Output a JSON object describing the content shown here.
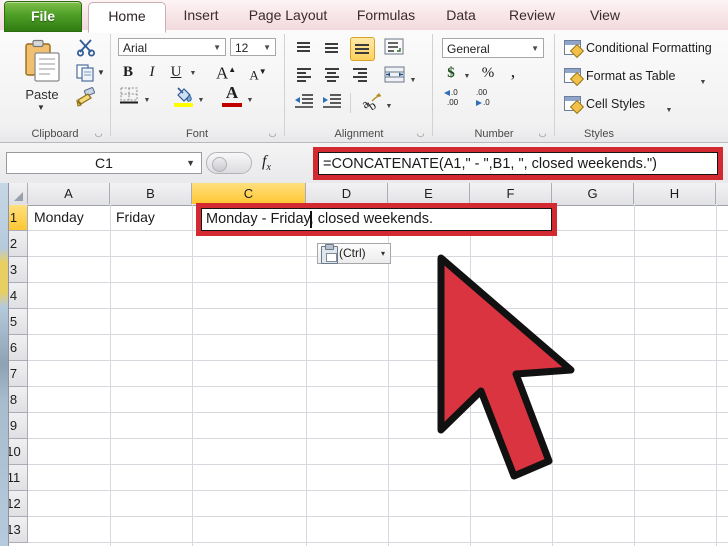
{
  "app": {
    "name": "Microsoft Excel 2010",
    "accent_red": "#d32a32",
    "accent_green": "#4e9e26",
    "selection_yellow": "#ffc732"
  },
  "tabs": [
    {
      "label": "File",
      "state": "file"
    },
    {
      "label": "Home",
      "state": "active"
    },
    {
      "label": "Insert",
      "state": "normal"
    },
    {
      "label": "Page Layout",
      "state": "normal"
    },
    {
      "label": "Formulas",
      "state": "normal"
    },
    {
      "label": "Data",
      "state": "normal"
    },
    {
      "label": "Review",
      "state": "normal"
    },
    {
      "label": "View",
      "state": "normal"
    }
  ],
  "ribbon": {
    "clipboard": {
      "label": "Clipboard",
      "paste_label": "Paste",
      "cut_icon": "scissors-icon",
      "copy_icon": "copy-icon",
      "format_painter_icon": "format-painter-icon",
      "dialog_launcher": "dialog-launcher-icon"
    },
    "font": {
      "label": "Font",
      "font_name": "Arial",
      "font_size": "12",
      "bold": "B",
      "italic": "I",
      "underline": "U",
      "grow_font": "A",
      "shrink_font": "A",
      "borders_icon": "borders-icon",
      "fill_color": "A",
      "fill_color_swatch": "#ffff00",
      "font_color": "A",
      "font_color_swatch": "#c00000",
      "dialog_launcher": "dialog-launcher-icon"
    },
    "alignment": {
      "label": "Alignment",
      "buttons": [
        "align-top",
        "align-middle",
        "align-bottom",
        "wrap-text",
        "align-left",
        "align-center",
        "align-right",
        "merge-and-center",
        "decrease-indent",
        "increase-indent",
        "orientation"
      ],
      "selected": "align-middle",
      "dialog_launcher": "dialog-launcher-icon"
    },
    "number": {
      "label": "Number",
      "format": "General",
      "currency": "$",
      "percent": "%",
      "comma": ",",
      "increase_decimal": ".00",
      "decrease_decimal": ".00",
      "dialog_launcher": "dialog-launcher-icon"
    },
    "styles": {
      "label": "Styles",
      "items": [
        {
          "label": "Conditional Formatting",
          "has_caret": false
        },
        {
          "label": "Format as Table",
          "has_caret": true
        },
        {
          "label": "Cell Styles",
          "has_caret": true
        }
      ]
    }
  },
  "formula_bar": {
    "name_box": "C1",
    "fx_label": "fx",
    "formula": "=CONCATENATE(A1,\" - \",B1, \", closed weekends.\")"
  },
  "grid": {
    "columns": [
      "A",
      "B",
      "C",
      "D",
      "E",
      "F",
      "G",
      "H"
    ],
    "selected_column": "C",
    "rows": [
      "1",
      "2",
      "3",
      "4",
      "5",
      "6",
      "7",
      "8",
      "9",
      "10",
      "11",
      "12",
      "13"
    ],
    "selected_row": "1",
    "cells": {
      "A1": "Monday",
      "B1": "Friday",
      "C1": "Monday - Friday, closed weekends."
    }
  },
  "smart_tag": {
    "icon": "paste-options-icon",
    "label": "(Ctrl)",
    "caret": "▾"
  },
  "annotations": {
    "formula_highlight": "red-box-around-formula-bar",
    "cell_highlight": "red-box-around-cell-c1",
    "pointer": "large-red-arrow-cursor"
  }
}
